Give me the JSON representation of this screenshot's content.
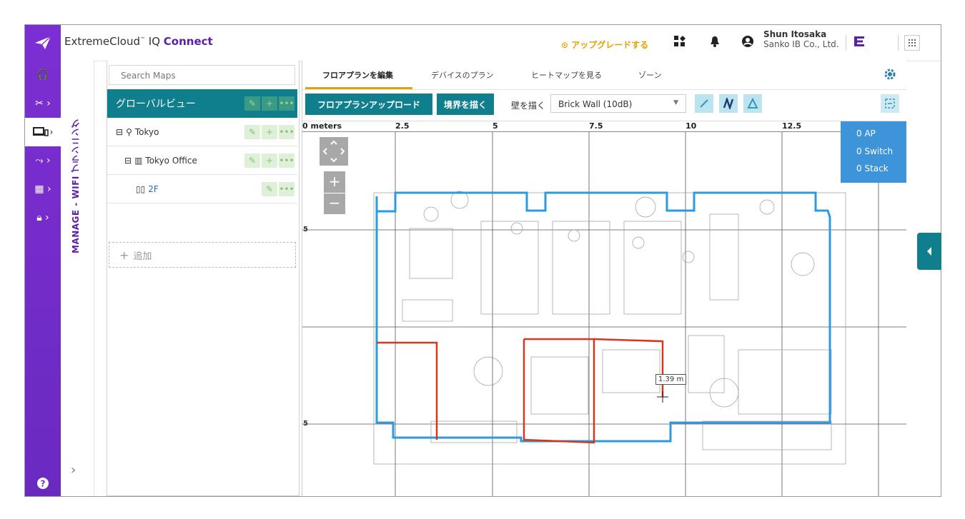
{
  "brand": {
    "prefix": "ExtremeCloud",
    "tm": "™",
    "mid": " IQ ",
    "bold": "Connect"
  },
  "header": {
    "upgrade_label": "アップグレードする",
    "user_name": "Shun Itosaka",
    "user_company": "Sanko IB Co., Ltd."
  },
  "sidebar_label": "MANAGE - WIFI プランニング",
  "tree": {
    "search_placeholder": "Search Maps",
    "global_view": "グローバルビュー",
    "items": [
      {
        "label": "Tokyo"
      },
      {
        "label": "Tokyo Office"
      },
      {
        "label": "2F"
      }
    ],
    "add_label": "追加"
  },
  "tabs": [
    {
      "label": "フロアプランを編集"
    },
    {
      "label": "デバイスのプラン"
    },
    {
      "label": "ヒートマップを見る"
    },
    {
      "label": "ゾーン"
    }
  ],
  "toolbar": {
    "upload_label": "フロアプランアップロード",
    "boundary_label": "境界を描く",
    "wall_label": "壁を描く",
    "wall_type": "Brick Wall (10dB)"
  },
  "ruler": {
    "labels": [
      "0 meters",
      "2.5",
      "5",
      "7.5",
      "10",
      "12.5"
    ]
  },
  "side_ticks": [
    "5",
    "5"
  ],
  "stats": {
    "ap": "0 AP",
    "switch": "0 Switch",
    "stack": "0 Stack"
  },
  "measure": "1.39 m",
  "colors": {
    "purple": "#7b2ed1",
    "teal": "#0f7f8e",
    "blue_boundary": "#2a9be0",
    "red_wall": "#d4381e",
    "upgrade": "#e6a100"
  }
}
